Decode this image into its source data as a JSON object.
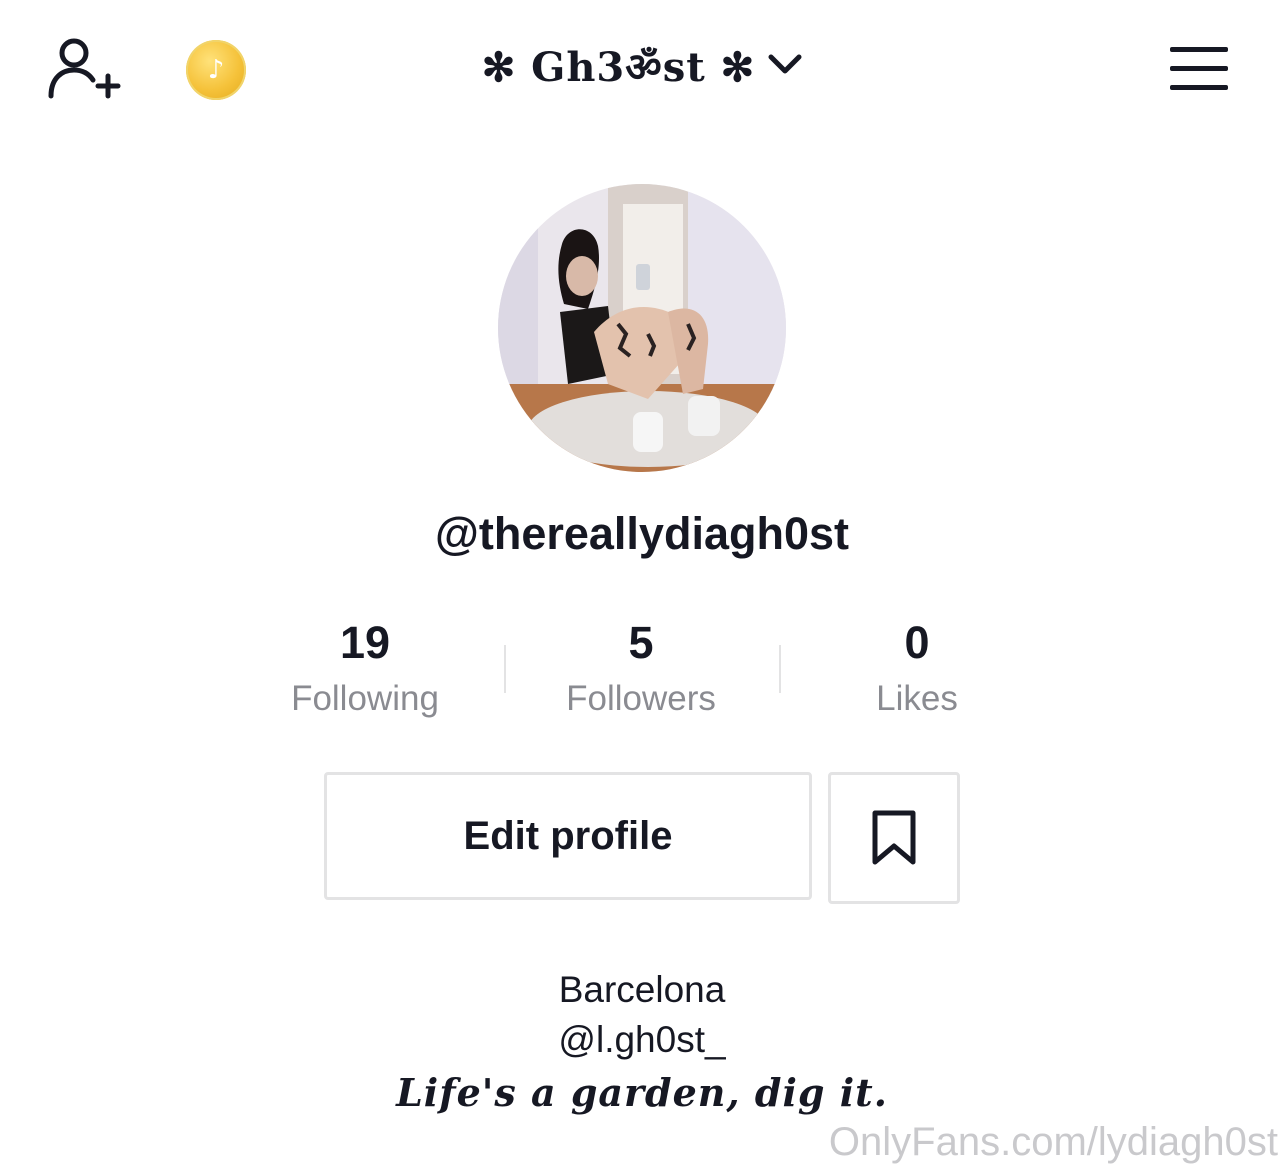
{
  "header": {
    "title": "✻ Gh3ॐst ✻",
    "icons": [
      "add-user-icon",
      "coin-icon",
      "chevron-down-icon",
      "menu-icon"
    ],
    "coin_glyph": "♪"
  },
  "profile": {
    "username": "@thereallydiagh0st",
    "stats": [
      {
        "value": "19",
        "label": "Following"
      },
      {
        "value": "5",
        "label": "Followers"
      },
      {
        "value": "0",
        "label": "Likes"
      }
    ],
    "edit_label": "Edit profile",
    "bio": [
      "Barcelona",
      "@l.gh0st_"
    ],
    "tagline": "Life's a garden, dig it."
  },
  "watermark": "OnlyFans.com/lydiagh0st",
  "colors": {
    "text": "#161823",
    "muted": "#8a8b91",
    "border": "#e3e3e4",
    "coin": "#f5c23a"
  }
}
